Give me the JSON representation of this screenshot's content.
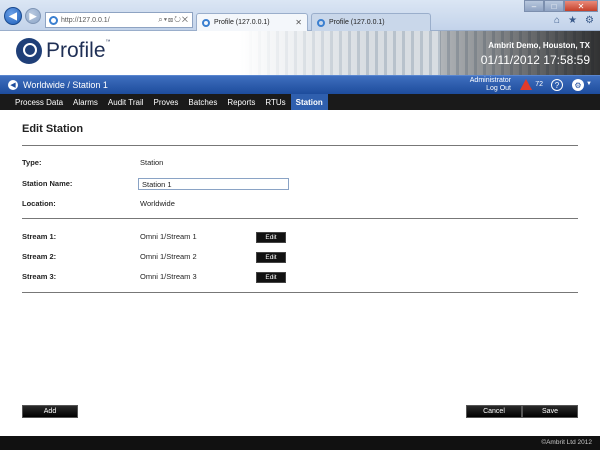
{
  "browser": {
    "url": "http://127.0.0.1/",
    "tabs": [
      {
        "label": "Profile (127.0.0.1)",
        "active": true
      },
      {
        "label": "Profile (127.0.0.1)",
        "active": false
      }
    ],
    "close_glyph": "✕",
    "nav_back_icon": "back-arrow-icon",
    "nav_forward_icon": "forward-arrow-icon"
  },
  "header": {
    "logo_text": "Profile",
    "logo_tm": "™",
    "site": "Ambrit Demo, Houston, TX",
    "datetime": "01/11/2012  17:58:59"
  },
  "breadcrumb": {
    "text": "Worldwide / Station 1",
    "user": "Administrator",
    "logout": "Log Out",
    "alarm_count": "72"
  },
  "nav": {
    "tabs": [
      "Process Data",
      "Alarms",
      "Audit Trail",
      "Proves",
      "Batches",
      "Reports",
      "RTUs",
      "Station"
    ],
    "selected": "Station"
  },
  "form": {
    "title": "Edit Station",
    "type_label": "Type:",
    "type_value": "Station",
    "name_label": "Station Name:",
    "name_value": "Station 1",
    "location_label": "Location:",
    "location_value": "Worldwide",
    "streams": [
      {
        "label": "Stream 1:",
        "value": "Omni 1/Stream 1",
        "edit": "Edit"
      },
      {
        "label": "Stream 2:",
        "value": "Omni 1/Stream 2",
        "edit": "Edit"
      },
      {
        "label": "Stream 3:",
        "value": "Omni 1/Stream 3",
        "edit": "Edit"
      }
    ]
  },
  "actions": {
    "add": "Add",
    "cancel": "Cancel",
    "save": "Save"
  },
  "footer": {
    "copyright": "©Ambrit Ltd 2012"
  },
  "colors": {
    "accent": "#2f5fae",
    "nav_bg": "#1a1a1a",
    "alarm": "#e13b2b"
  }
}
